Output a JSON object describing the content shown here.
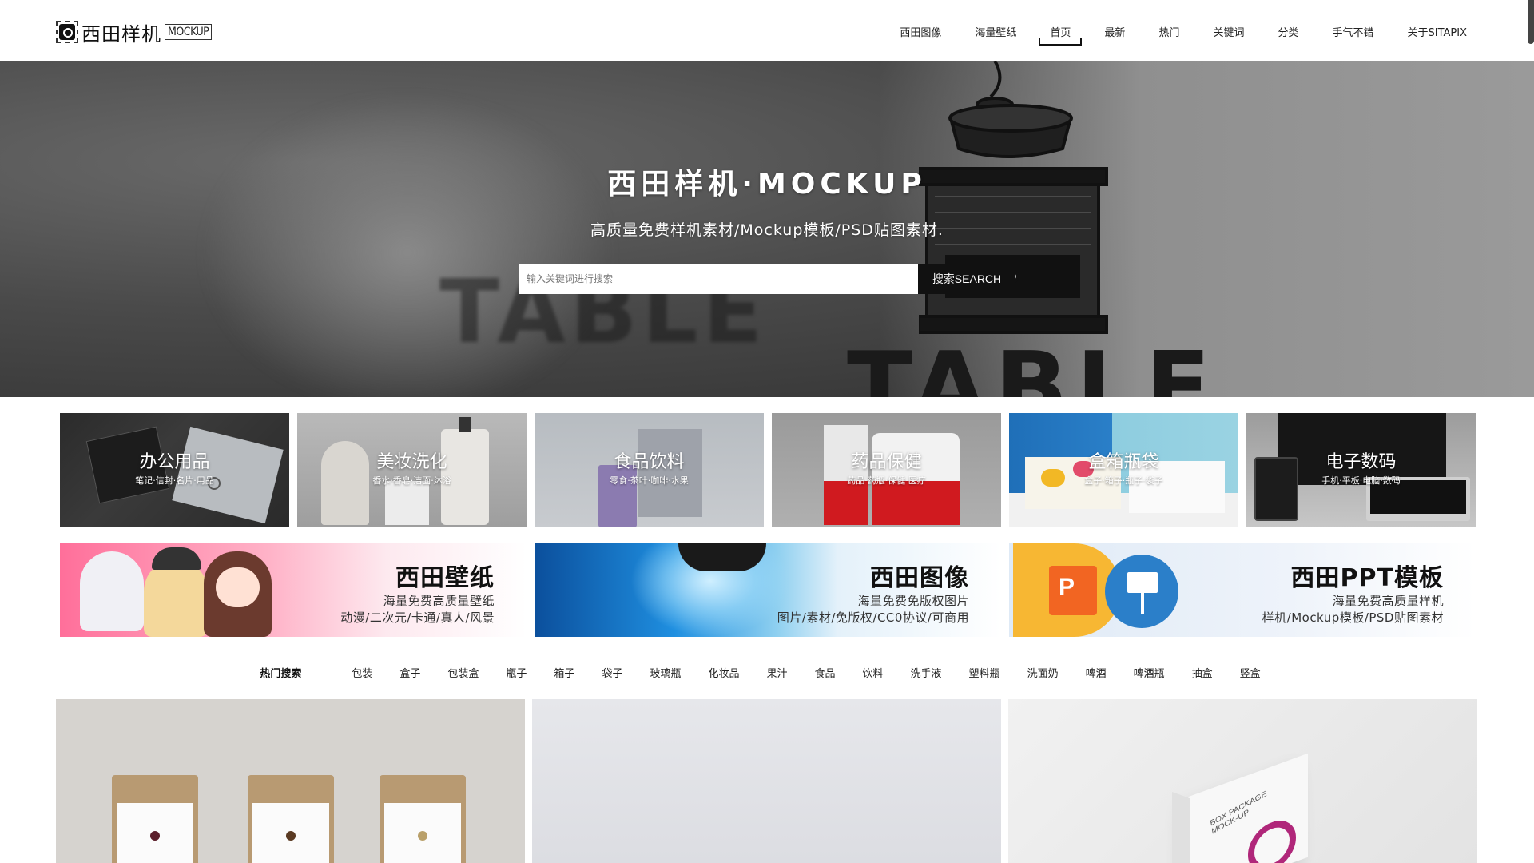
{
  "header": {
    "logo_cn": "西田样机",
    "logo_en": "MOCKUP",
    "nav": [
      "西田图像",
      "海量壁纸",
      "首页",
      "最新",
      "热门",
      "关键词",
      "分类",
      "手气不错",
      "关于SITAPIX"
    ],
    "active_nav": "首页"
  },
  "hero": {
    "title": "西田样机·MOCKUP",
    "subtitle": "高质量免费样机素材/Mockup模板/PSD贴图素材.",
    "search_placeholder": "输入关键词进行搜索",
    "search_button": "搜索SEARCH",
    "bg_text_blurred": "TABLE",
    "bg_text_sharp": "TABLE"
  },
  "categories": [
    {
      "title": "办公用品",
      "sub": "笔记·信封·名片·用品"
    },
    {
      "title": "美妆洗化",
      "sub": "香水·香皂·洁面·沐浴"
    },
    {
      "title": "食品饮料",
      "sub": "零食·茶叶·咖啡·水果"
    },
    {
      "title": "药品保健",
      "sub": "药品·药瓶·保健·医疗"
    },
    {
      "title": "盒箱瓶袋",
      "sub": "盒子·箱子·瓶子·袋子"
    },
    {
      "title": "电子数码",
      "sub": "手机·平板·电脑·数码"
    }
  ],
  "banners": [
    {
      "title": "西田壁纸",
      "line1": "海量免费高质量壁纸",
      "line2": "动漫/二次元/卡通/真人/风景"
    },
    {
      "title": "西田图像",
      "line1": "海量免费免版权图片",
      "line2": "图片/素材/免版权/CC0协议/可商用"
    },
    {
      "title": "西田PPT模板",
      "line1": "海量免费高质量样机",
      "line2": "样机/Mockup模板/PSD贴图素材"
    }
  ],
  "hot_search": {
    "label": "热门搜索",
    "items": [
      "包装",
      "盒子",
      "包装盒",
      "瓶子",
      "箱子",
      "袋子",
      "玻璃瓶",
      "化妆品",
      "果汁",
      "食品",
      "饮料",
      "洗手液",
      "塑料瓶",
      "洗面奶",
      "啤酒",
      "啤酒瓶",
      "抽盒",
      "竖盒"
    ]
  },
  "cards": {
    "card3_box_text": "BOX PACKAGE MOCK-UP"
  },
  "colors": {
    "accent": "#111111",
    "banner_pink": "#ff8fb0",
    "banner_blue": "#1a7fd0",
    "ppt_orange": "#f26522"
  }
}
